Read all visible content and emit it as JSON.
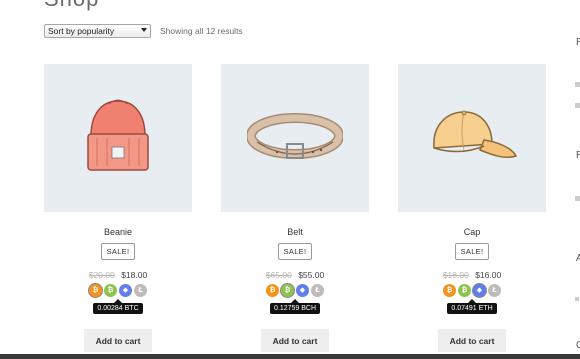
{
  "page": {
    "heading": "Shop"
  },
  "toolbar": {
    "sort_selected": "Sort by popularity",
    "result_count": "Showing all 12 results"
  },
  "colors": {
    "btc": "#f7931a",
    "bch": "#8dc351",
    "eth": "#627eea",
    "ltc": "#bfbbbb"
  },
  "products": [
    {
      "name": "Beanie",
      "sale_badge": "SALE!",
      "regular_price": "$20.00",
      "sale_price": "$18.00",
      "crypto_tooltip": "0.00284 BTC",
      "active_coin": "btc",
      "add_to_cart": "Add to cart"
    },
    {
      "name": "Belt",
      "sale_badge": "SALE!",
      "regular_price": "$65.00",
      "sale_price": "$55.00",
      "crypto_tooltip": "0.12759 BCH",
      "active_coin": "bch",
      "add_to_cart": "Add to cart"
    },
    {
      "name": "Cap",
      "sale_badge": "SALE!",
      "regular_price": "$18.00",
      "sale_price": "$16.00",
      "crypto_tooltip": "0.07491 ETH",
      "active_coin": "eth",
      "add_to_cart": "Add to cart"
    }
  ],
  "sidebar_fragments": [
    "R",
    "R",
    "A",
    "C"
  ]
}
